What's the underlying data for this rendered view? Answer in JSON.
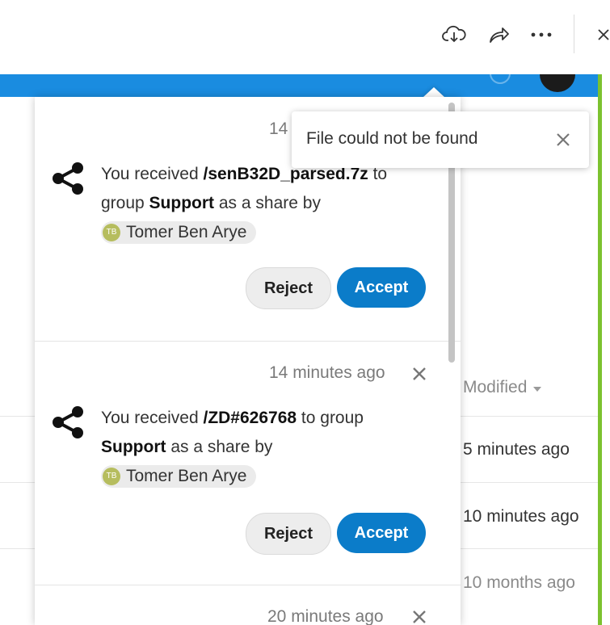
{
  "toolbar": {
    "download_icon": "cloud-download-icon",
    "share_icon": "share-arrow-icon",
    "more_icon": "more-horizontal-icon",
    "close_icon": "close-icon"
  },
  "file_list": {
    "column_modified": "Modified",
    "rows": [
      {
        "modified": "5 minutes ago"
      },
      {
        "modified": "10 minutes ago"
      },
      {
        "modified": "10 months ago"
      }
    ]
  },
  "toast": {
    "message": "File could not be found"
  },
  "notifications": [
    {
      "time": "14",
      "prefix": "You received ",
      "file": "/senB32D_parsed.7z",
      "mid": " to group ",
      "group": "Support",
      "suffix": " as a share by",
      "user_initials": "TB",
      "user_name": "Tomer Ben Arye",
      "reject_label": "Reject",
      "accept_label": "Accept"
    },
    {
      "time": "14 minutes ago",
      "prefix": "You received ",
      "file": "/ZD#626768",
      "mid": " to group ",
      "group": "Support",
      "suffix": " as a share by",
      "user_initials": "TB",
      "user_name": "Tomer Ben Arye",
      "reject_label": "Reject",
      "accept_label": "Accept"
    },
    {
      "time": "20 minutes ago"
    }
  ],
  "colors": {
    "app_header": "#1a8ce0",
    "accent_green": "#7cc22f",
    "accept_button": "#0b7cc9"
  }
}
